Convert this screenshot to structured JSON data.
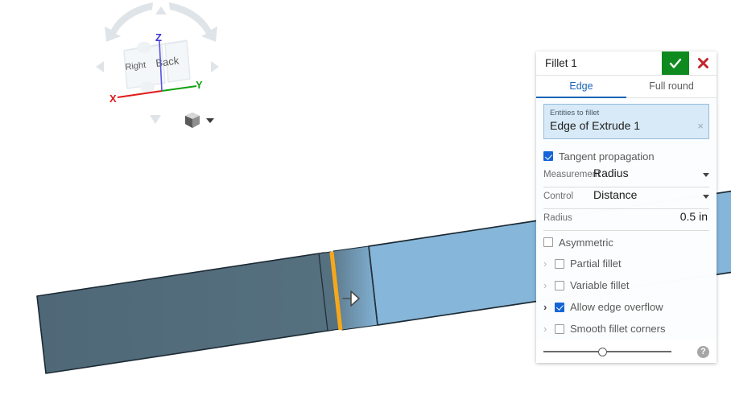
{
  "app": {
    "name": "onshape-modeling-viewport"
  },
  "viewcube": {
    "visible_faces": [
      {
        "label": "Right"
      },
      {
        "label": "Back"
      }
    ],
    "axes": [
      {
        "label": "X",
        "color": "#e01b1b"
      },
      {
        "label": "Y",
        "color": "#11a111"
      },
      {
        "label": "Z",
        "color": "#3a35d8"
      }
    ],
    "nav_arrows": [
      "up-arrow",
      "down-arrow",
      "left-arrow",
      "right-arrow"
    ],
    "rotate_arrows": [
      "rotate-left-arrow",
      "rotate-right-arrow"
    ]
  },
  "display_style": {
    "icon": "shaded-cube-icon",
    "dropdown": "chevron-down-icon"
  },
  "model": {
    "selected_edge_color": "#f5a81c",
    "face_dark_color": "#51697c",
    "face_light_color": "#85b5d8",
    "edge_line_color": "#1c2a33",
    "cursor": "edge-select-arrow-cursor"
  },
  "dialog": {
    "title": "Fillet 1",
    "accept_label": "✓",
    "cancel_label": "✕",
    "accept_color": "#0f8a1e",
    "cancel_color": "#c0272d",
    "tabs": [
      {
        "label": "Edge",
        "active": true
      },
      {
        "label": "Full round",
        "active": false
      }
    ],
    "entities": {
      "label": "Entities to fillet",
      "value": "Edge of Extrude 1",
      "clear_label": "×"
    },
    "tangent_propagation": {
      "label": "Tangent propagation",
      "checked": true
    },
    "measurement": {
      "label": "Measurement",
      "value": "Radius"
    },
    "control": {
      "label": "Control",
      "value": "Distance"
    },
    "radius": {
      "label": "Radius",
      "value": "0.5 in"
    },
    "asymmetric": {
      "label": "Asymmetric",
      "checked": false
    },
    "options": [
      {
        "label": "Partial fillet",
        "checked": false,
        "expanded": false
      },
      {
        "label": "Variable fillet",
        "checked": false,
        "expanded": false
      },
      {
        "label": "Allow edge overflow",
        "checked": true,
        "expanded": false
      },
      {
        "label": "Smooth fillet corners",
        "checked": false,
        "expanded": false
      }
    ],
    "footer": {
      "slider_value": "50",
      "help_label": "?"
    }
  }
}
